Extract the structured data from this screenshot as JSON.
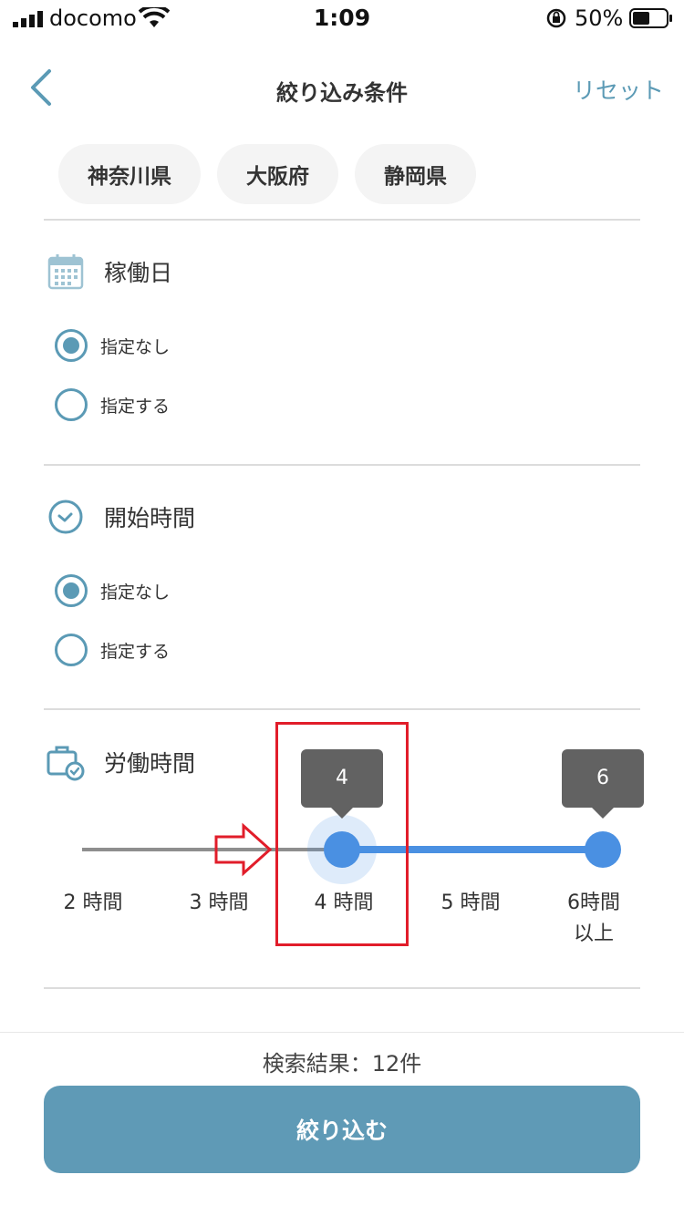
{
  "status_bar": {
    "carrier": "docomo",
    "time": "1:09",
    "battery_percent": "50%"
  },
  "nav": {
    "title": "絞り込み条件",
    "reset_label": "リセット"
  },
  "chips": [
    "神奈川県",
    "大阪府",
    "静岡県"
  ],
  "working_day": {
    "label": "稼働日",
    "options": [
      "指定なし",
      "指定する"
    ],
    "selected": 0
  },
  "start_time": {
    "label": "開始時間",
    "options": [
      "指定なし",
      "指定する"
    ],
    "selected": 0
  },
  "work_hours": {
    "label": "労働時間",
    "ticks": [
      "2 時間",
      "3 時間",
      "4 時間",
      "5 時間",
      "6時間\n以上"
    ],
    "range_min": 4,
    "range_max": 6,
    "min_label": "4",
    "max_label": "6"
  },
  "footer": {
    "result_text": "検索結果：12件",
    "submit_label": "絞り込む"
  },
  "colors": {
    "accent": "#5b9ab5",
    "slider_active": "#4a90e2",
    "slider_inactive": "#8e8e8e",
    "annotation": "#e11d2a"
  }
}
